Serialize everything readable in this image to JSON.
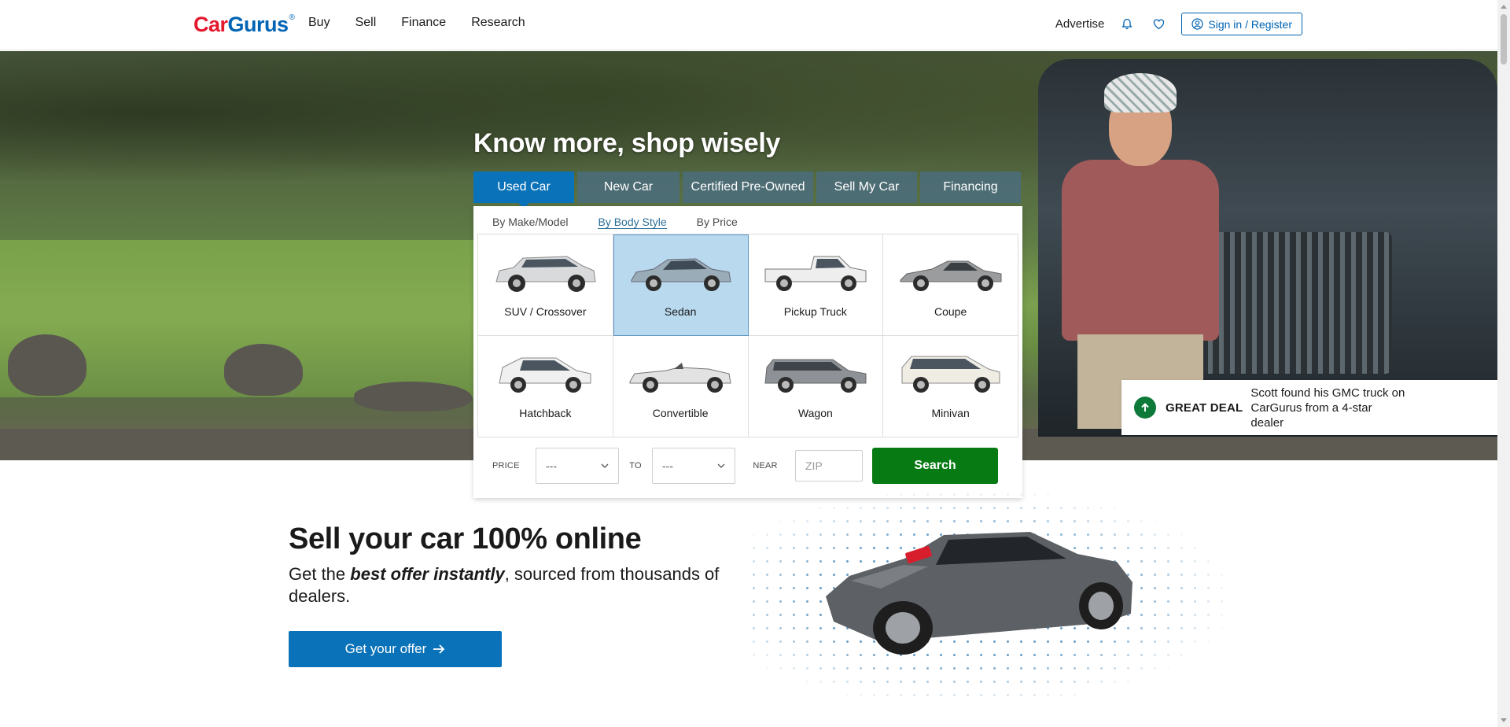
{
  "header": {
    "logo_car": "Car",
    "logo_gurus": "Gurus",
    "logo_reg": "®",
    "nav": [
      "Buy",
      "Sell",
      "Finance",
      "Research"
    ],
    "advertise": "Advertise",
    "signin": "Sign in / Register"
  },
  "hero": {
    "title": "Know more, shop wisely",
    "tabs": [
      "Used Car",
      "New Car",
      "Certified Pre-Owned",
      "Sell My Car",
      "Financing"
    ],
    "active_tab": "Used Car",
    "subtabs": [
      "By Make/Model",
      "By Body Style",
      "By Price"
    ],
    "active_subtab": "By Body Style",
    "body_styles": [
      "SUV / Crossover",
      "Sedan",
      "Pickup Truck",
      "Coupe",
      "Hatchback",
      "Convertible",
      "Wagon",
      "Minivan"
    ],
    "selected_body_style": "Sedan",
    "filters": {
      "price_label": "PRICE",
      "price_from": "---",
      "to_label": "TO",
      "price_to": "---",
      "near_label": "NEAR",
      "zip_placeholder": "ZIP",
      "search_label": "Search"
    }
  },
  "deal": {
    "label": "GREAT DEAL",
    "description": "Scott found his GMC truck on CarGurus from a 4-star dealer"
  },
  "sell": {
    "title": "Sell your car 100% online",
    "subtitle_pre": "Get the ",
    "subtitle_em": "best offer instantly",
    "subtitle_post": ", sourced from thousands of dealers.",
    "cta": "Get your offer"
  },
  "colors": {
    "brand_blue": "#0a72b8",
    "brand_red": "#e3182d",
    "search_green": "#077a13",
    "tab_inactive": "#4c6c78",
    "deal_green": "#0d7a3a"
  },
  "icons": {
    "bell": "bell-icon",
    "heart": "heart-icon",
    "user": "user-circle-icon",
    "chevron": "chevron-down-icon",
    "arrow_right": "arrow-right-icon",
    "arrow_up": "arrow-up-icon"
  }
}
